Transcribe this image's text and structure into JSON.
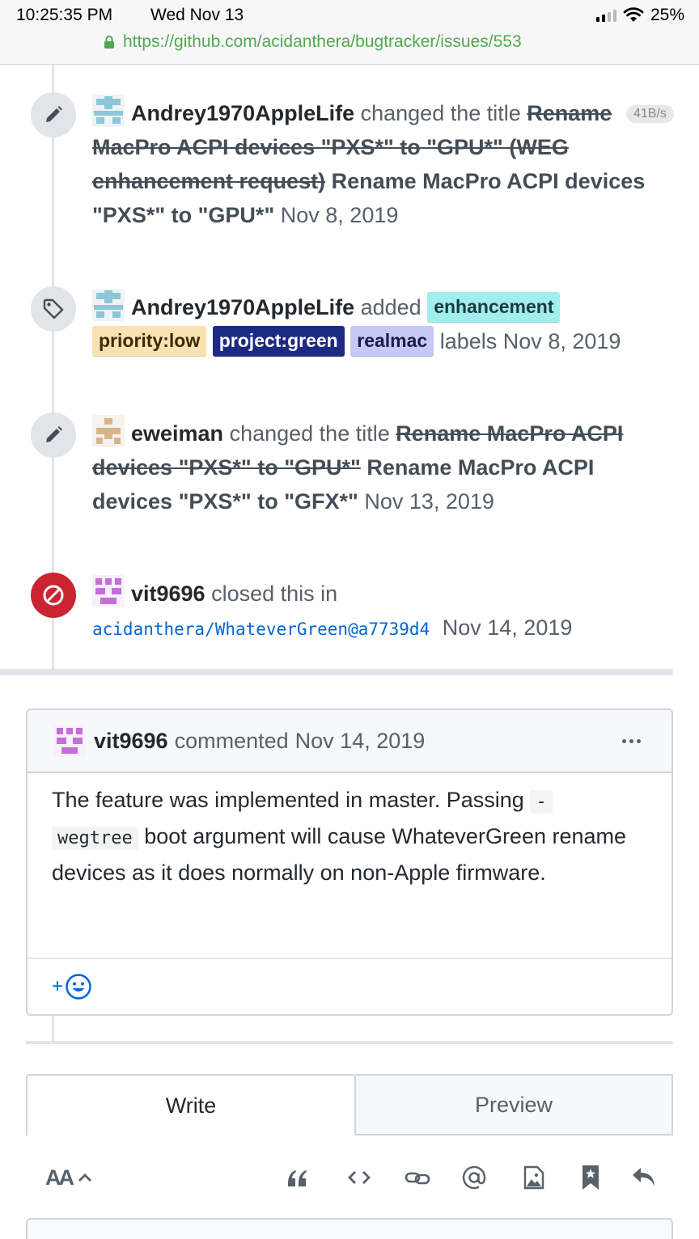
{
  "status_bar": {
    "time": "10:25:35 PM",
    "date": "Wed Nov 13",
    "battery": "25%",
    "url": "https://github.com/acidanthera/bugtracker/issues/553"
  },
  "speed_badge": "41B/s",
  "events": {
    "rename1": {
      "author": "Andrey1970AppleLife",
      "action": "changed the title",
      "old_title": "Rename MacPro ACPI devices \"PXS*\" to \"GPU*\" (WEG enhancement request)",
      "new_title": "Rename MacPro ACPI devices \"PXS*\" to \"GPU*\"",
      "date": "Nov 8, 2019"
    },
    "labels": {
      "author": "Andrey1970AppleLife",
      "action": "added",
      "label_enhancement": "enhancement",
      "label_priority": "priority:low",
      "label_project": "project:green",
      "label_realmac": "realmac",
      "suffix": "labels",
      "date": "Nov 8, 2019"
    },
    "rename2": {
      "author": "eweiman",
      "action": "changed the title",
      "old_title": "Rename MacPro ACPI devices \"PXS*\" to \"GPU*\"",
      "new_title": "Rename MacPro ACPI devices \"PXS*\" to \"GFX*\"",
      "date": "Nov 13, 2019"
    },
    "closed": {
      "author": "vit9696",
      "action": "closed this in",
      "commit": "acidanthera/WhateverGreen@a7739d4",
      "date": "Nov 14, 2019"
    }
  },
  "comment": {
    "author": "vit9696",
    "action": "commented",
    "date": "Nov 14, 2019",
    "body_1": "The feature was implemented in master. Passing",
    "code_1": "-",
    "code_2": "wegtree",
    "body_2": "boot argument will cause WhateverGreen rename devices as it does normally on non-Apple firmware.",
    "reaction_plus": "+"
  },
  "editor": {
    "tab_write": "Write",
    "tab_preview": "Preview",
    "text_size_label": "AA"
  },
  "colors": {
    "label_enhancement": "#a2eeef",
    "label_priority": "#f9e2b2",
    "label_project": "#1d2a84",
    "label_realmac": "#c5c8f8",
    "closed_badge": "#cb2431",
    "link": "#0366d6"
  }
}
